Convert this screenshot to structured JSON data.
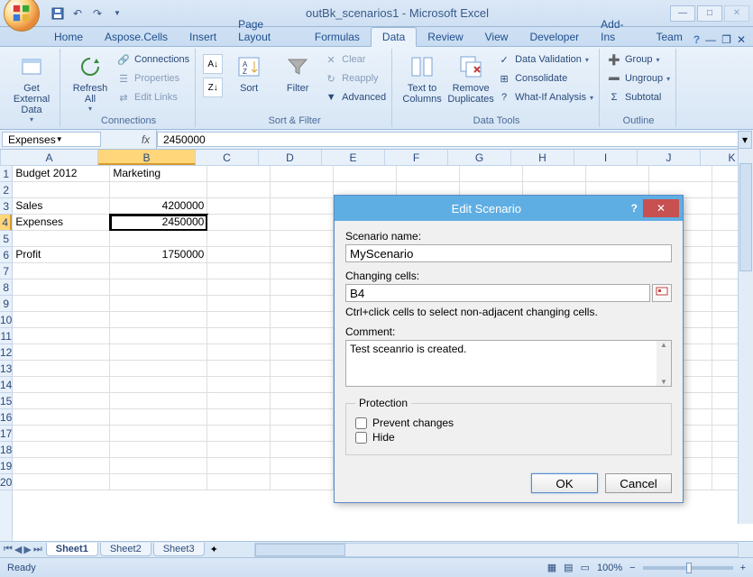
{
  "window": {
    "title": "outBk_scenarios1 - Microsoft Excel",
    "min": "—",
    "max": "□",
    "close": "✕"
  },
  "tabs": [
    "Home",
    "Aspose.Cells",
    "Insert",
    "Page Layout",
    "Formulas",
    "Data",
    "Review",
    "View",
    "Developer",
    "Add-Ins",
    "Team"
  ],
  "tabs_active": "Data",
  "ribbon": {
    "g1": {
      "label": "",
      "btn": "Get External\nData"
    },
    "g2": {
      "label": "Connections",
      "btn": "Refresh\nAll",
      "i1": "Connections",
      "i2": "Properties",
      "i3": "Edit Links"
    },
    "g3": {
      "label": "Sort & Filter",
      "sort": "Sort",
      "filter": "Filter",
      "clear": "Clear",
      "reapply": "Reapply",
      "adv": "Advanced"
    },
    "g4": {
      "label": "Data Tools",
      "ttc": "Text to\nColumns",
      "rd": "Remove\nDuplicates",
      "dv": "Data Validation",
      "cons": "Consolidate",
      "wia": "What-If Analysis"
    },
    "g5": {
      "label": "Outline",
      "grp": "Group",
      "ugrp": "Ungroup",
      "sub": "Subtotal"
    }
  },
  "name_box": "Expenses",
  "formula": "2450000",
  "cols": [
    "A",
    "B",
    "C",
    "D",
    "E",
    "F",
    "G",
    "H",
    "I",
    "J",
    "K"
  ],
  "active_col": "B",
  "active_row": 4,
  "rows": 20,
  "cells": {
    "A1": "Budget 2012",
    "B1": "Marketing",
    "A3": "Sales",
    "B3": "4200000",
    "A4": "Expenses",
    "B4": "2450000",
    "A6": "Profit",
    "B6": "1750000"
  },
  "sheets": [
    "Sheet1",
    "Sheet2",
    "Sheet3"
  ],
  "active_sheet": "Sheet1",
  "status": {
    "ready": "Ready",
    "zoom": "100%"
  },
  "dialog": {
    "title": "Edit Scenario",
    "name_lbl": "Scenario name:",
    "name_val": "MyScenario",
    "cc_lbl": "Changing cells:",
    "cc_val": "B4",
    "cc_hint": "Ctrl+click cells to select non-adjacent changing cells.",
    "comment_lbl": "Comment:",
    "comment_val": "Test sceanrio is created.",
    "protection": "Protection",
    "prevent": "Prevent changes",
    "hide": "Hide",
    "ok": "OK",
    "cancel": "Cancel"
  }
}
